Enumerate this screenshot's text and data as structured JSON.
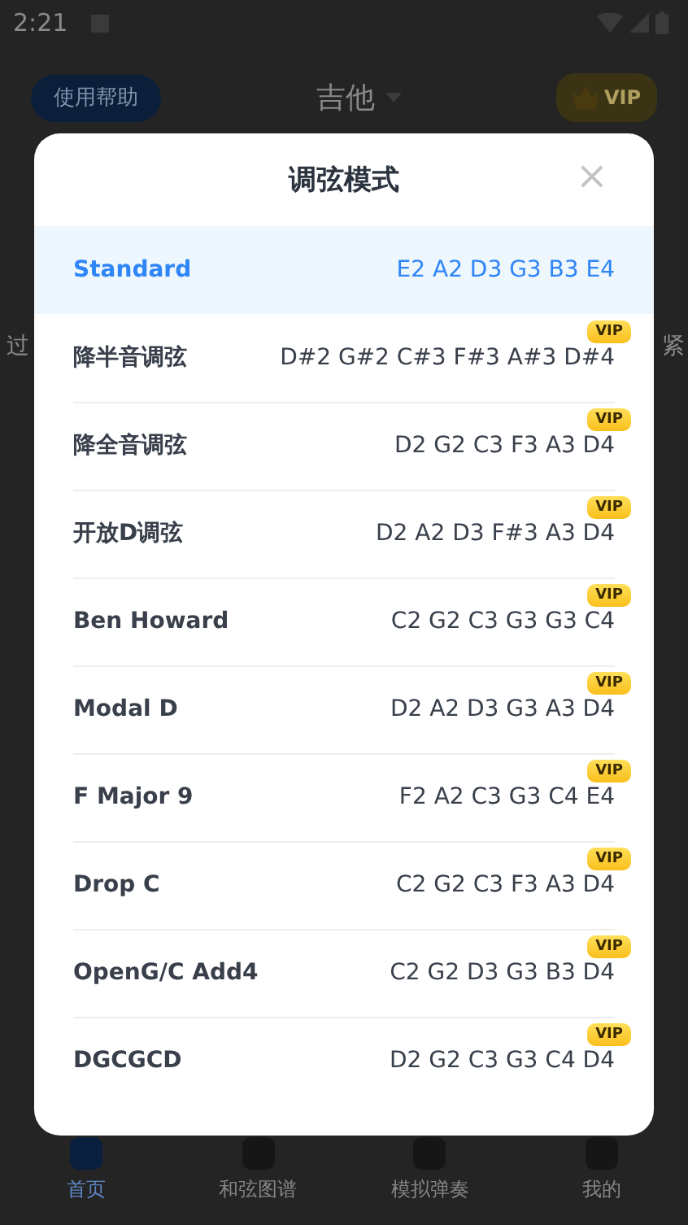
{
  "status_bar": {
    "time": "2:21"
  },
  "header": {
    "help_button": "使用帮助",
    "title": "吉他",
    "vip_button": "VIP"
  },
  "side_texts": [
    "过",
    "紧"
  ],
  "dialog": {
    "title": "调弦模式",
    "close": "×",
    "tunings": [
      {
        "name": "Standard",
        "notes": "E2 A2 D3 G3 B3 E4",
        "selected": true
      },
      {
        "name": "降半音调弦",
        "notes": "D#2 G#2 C#3 F#3 A#3 D#4",
        "selected": false,
        "badge": "VIP"
      },
      {
        "name": "降全音调弦",
        "notes": "D2 G2 C3 F3 A3 D4",
        "selected": false,
        "badge": "VIP"
      },
      {
        "name": "开放D调弦",
        "notes": "D2 A2 D3 F#3 A3 D4",
        "selected": false,
        "badge": "VIP"
      },
      {
        "name": "Ben Howard",
        "notes": "C2 G2 C3 G3 G3 C4",
        "selected": false,
        "badge": "VIP"
      },
      {
        "name": "Modal D",
        "notes": "D2 A2 D3 G3 A3 D4",
        "selected": false,
        "badge": "VIP"
      },
      {
        "name": "F Major 9",
        "notes": "F2 A2 C3 G3 C4 E4",
        "selected": false,
        "badge": "VIP"
      },
      {
        "name": "Drop C",
        "notes": "C2 G2 C3 F3 A3 D4",
        "selected": false,
        "badge": "VIP"
      },
      {
        "name": "OpenG/C Add4",
        "notes": "C2 G2 D3 G3 B3 D4",
        "selected": false,
        "badge": "VIP"
      },
      {
        "name": "DGCGCD",
        "notes": "D2 G2 C3 G3 C4 D4",
        "selected": false,
        "badge": "VIP"
      }
    ]
  },
  "bottom_nav": [
    {
      "label": "首页",
      "selected": true
    },
    {
      "label": "和弦图谱",
      "selected": false
    },
    {
      "label": "模拟弹奏",
      "selected": false
    },
    {
      "label": "我的",
      "selected": false
    }
  ]
}
